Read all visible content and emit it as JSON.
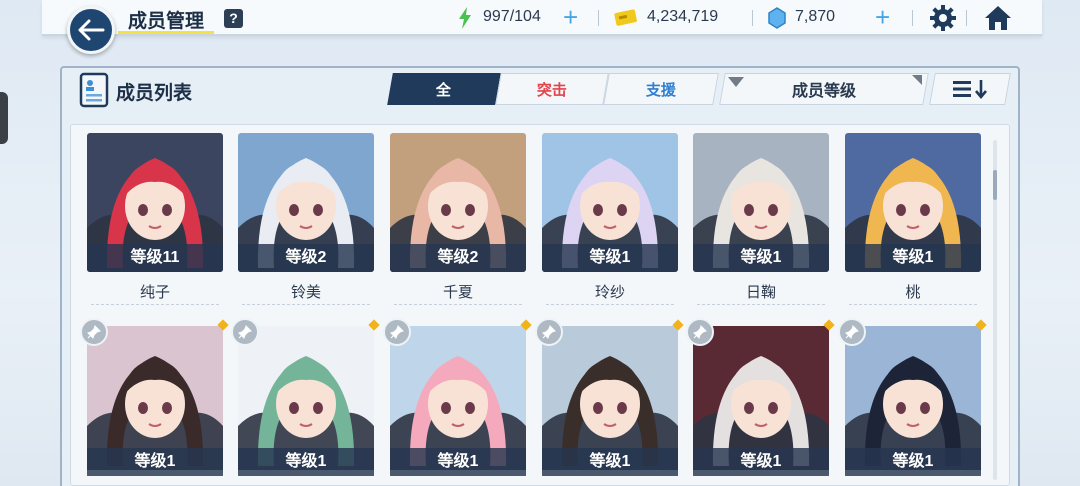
{
  "header": {
    "title": "成员管理",
    "help_label": "?",
    "energy": "997/104",
    "credits": "4,234,719",
    "gems": "7,870",
    "plus_label": "+"
  },
  "panel": {
    "title": "成员列表",
    "filters": [
      {
        "label": "全"
      },
      {
        "label": "突击"
      },
      {
        "label": "支援"
      }
    ],
    "sort_label": "成员等级"
  },
  "row1": [
    {
      "level": "等级11",
      "name": "纯子",
      "hair": "#d8354a",
      "bg": "#3b4560"
    },
    {
      "level": "等级2",
      "name": "铃美",
      "hair": "#e9edf3",
      "bg": "#7fa6cf"
    },
    {
      "level": "等级2",
      "name": "千夏",
      "hair": "#e9b7a6",
      "bg": "#c2a07d"
    },
    {
      "level": "等级1",
      "name": "玲纱",
      "hair": "#dcd4f2",
      "bg": "#9fc4e6"
    },
    {
      "level": "等级1",
      "name": "日鞠",
      "hair": "#e8e4e0",
      "bg": "#a8b3c2"
    },
    {
      "level": "等级1",
      "name": "桃",
      "hair": "#f0b64f",
      "bg": "#4f6aa0"
    }
  ],
  "row2": [
    {
      "level": "等级1",
      "hair": "#3b2a2a",
      "bg": "#d9c4cf"
    },
    {
      "level": "等级1",
      "hair": "#74b59a",
      "bg": "#eef1f5"
    },
    {
      "level": "等级1",
      "hair": "#f4a9bd",
      "bg": "#bfd6ea"
    },
    {
      "level": "等级1",
      "hair": "#3a2e2a",
      "bg": "#b9cbdb"
    },
    {
      "level": "等级1",
      "hair": "#e4e0df",
      "bg": "#5a2a34"
    },
    {
      "level": "等级1",
      "hair": "#1e2438",
      "bg": "#9bb5d6"
    }
  ]
}
